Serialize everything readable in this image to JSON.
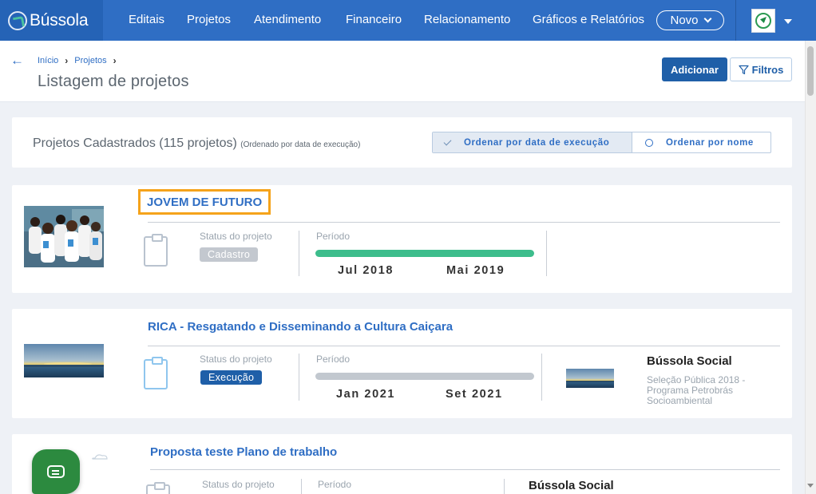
{
  "brand": {
    "name": "Bússola"
  },
  "nav": {
    "items": [
      "Editais",
      "Projetos",
      "Atendimento",
      "Financeiro",
      "Relacionamento",
      "Gráficos e Relatórios"
    ],
    "novo_label": "Novo"
  },
  "breadcrumb": {
    "items": [
      "Início",
      "Projetos"
    ]
  },
  "page": {
    "title": "Listagem de projetos"
  },
  "actions": {
    "add_label": "Adicionar",
    "filter_label": "Filtros"
  },
  "listing": {
    "heading": "Projetos Cadastrados (115 projetos)",
    "note": "(Ordenado por data de execução)",
    "sort_options": [
      "Ordenar por data de execução",
      "Ordenar por nome"
    ],
    "selected_sort": "Ordenar por data de execução"
  },
  "projects": [
    {
      "title": "JOVEM DE FUTURO",
      "status_label": "Status do projeto",
      "status": "Cadastro",
      "period_label": "Período",
      "start": "Jul 2018",
      "end": "Mai 2019",
      "progress": 1.0
    },
    {
      "title": "RICA - Resgatando e Disseminando a Cultura Caiçara",
      "status_label": "Status do projeto",
      "status": "Execução",
      "period_label": "Período",
      "start": "Jan 2021",
      "end": "Set 2021",
      "progress": 1.0,
      "org": "Bússola Social",
      "org_desc": "Seleção Pública 2018 - Programa Petrobrás Socioambiental"
    },
    {
      "title": "Proposta teste Plano de trabalho",
      "status_label": "Status do projeto",
      "period_label": "Período",
      "org": "Bússola Social"
    }
  ],
  "colors": {
    "nav_bg": "#2f6ec4",
    "primary": "#1f5fa8",
    "highlight": "#f5a31b",
    "progress_green": "#3dbd8c",
    "chat": "#2c8a3f"
  }
}
